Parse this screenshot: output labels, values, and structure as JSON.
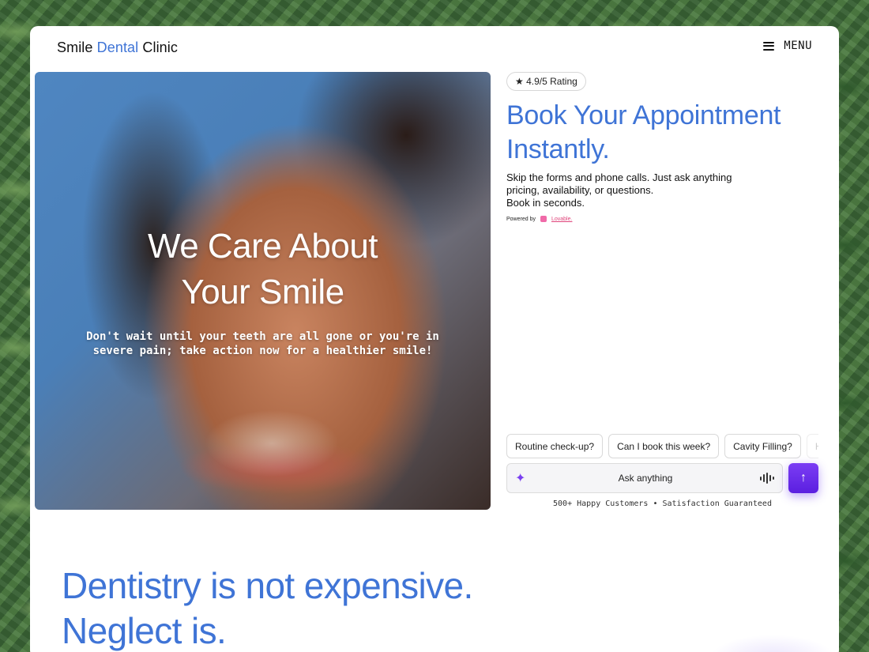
{
  "header": {
    "brand": {
      "part1": "Smile",
      "part2": "Dental",
      "part3": "Clinic"
    },
    "menu_label": "MENU",
    "menu_icon": "hamburger-icon"
  },
  "hero": {
    "title_line1": "We Care About",
    "title_line2": "Your Smile",
    "subtitle": "Don't wait until your teeth are all gone or you're in severe pain; take action now for a healthier smile!"
  },
  "booking": {
    "rating": "★ 4.9/5 Rating",
    "title_line1": "Book Your Appointment",
    "title_line2": "Instantly.",
    "desc_line1": "Skip the forms and phone calls. Just ask anything",
    "desc_line2": "pricing, availability, or questions.",
    "desc_line3": "Book in seconds.",
    "powered_by": "Powered by",
    "powered_brand": "Lovable."
  },
  "chips": [
    {
      "label": "Routine check-up?"
    },
    {
      "label": "Can I book this week?"
    },
    {
      "label": "Cavity Filling?"
    },
    {
      "label": "Ha"
    }
  ],
  "chat": {
    "placeholder": "Ask anything",
    "spark_icon": "sparkle-icon",
    "voice_icon": "voice-wave-icon",
    "send_icon": "arrow-up-icon"
  },
  "trust_line": "500+ Happy Customers • Satisfaction Guaranteed",
  "tagline": {
    "line1": "Dentistry is not expensive.",
    "line2": "Neglect is."
  },
  "colors": {
    "accent_blue": "#3f74d6",
    "send_purple": "#6a2ee8",
    "lovable_pink": "#e0457b"
  }
}
